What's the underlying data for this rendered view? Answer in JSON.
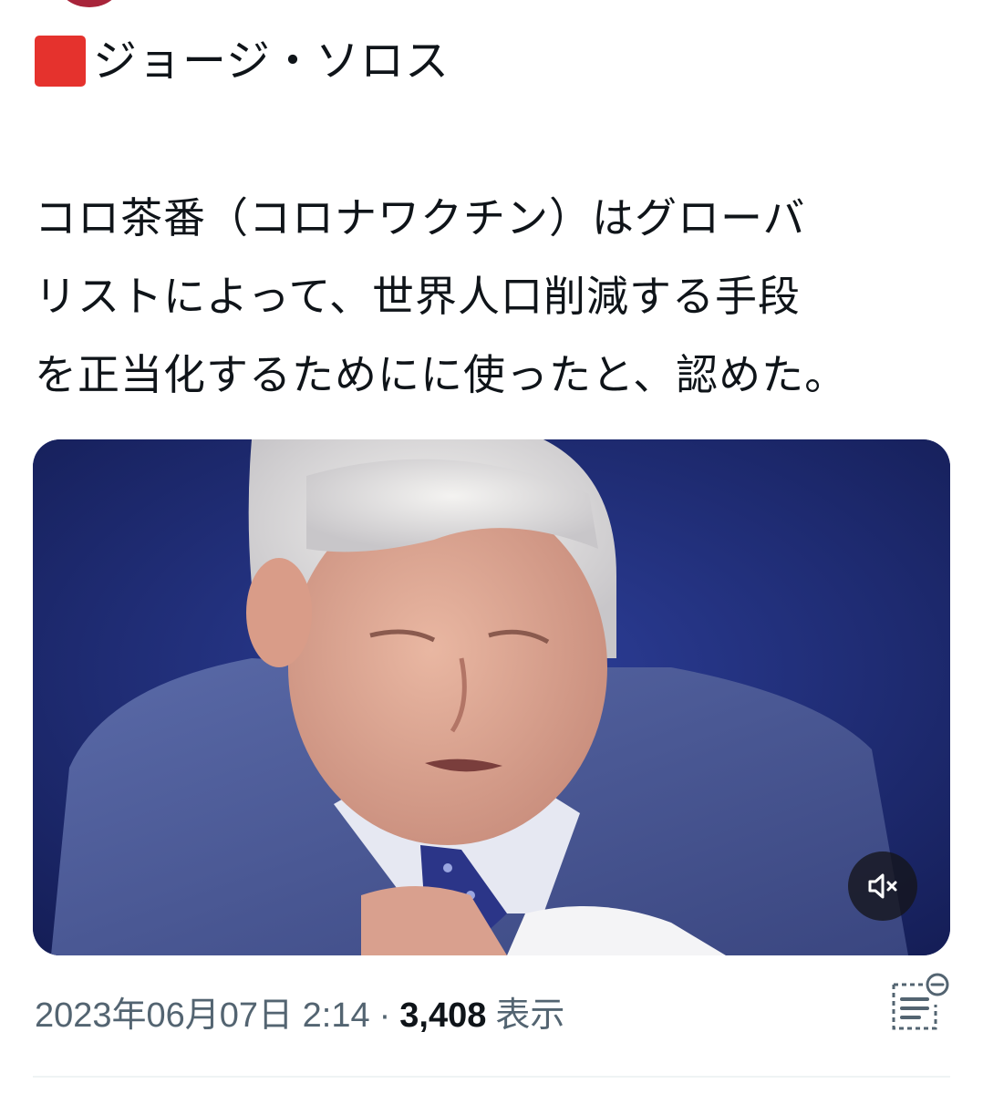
{
  "tweet": {
    "title": "ジョージ・ソロス",
    "title_icon": "red-square-icon",
    "body_lines": [
      "コロ茶番（コロナワクチン）はグローバ",
      "リストによって、世界人口削減する手段",
      "を正当化するためにに使ったと、認めた。"
    ],
    "media": {
      "type": "video",
      "mute_icon": "muted-speaker-icon"
    },
    "timestamp": "2023年06月07日 2:14",
    "separator": "·",
    "view_count": "3,408",
    "view_label": "表示",
    "note_icon": "community-note-icon"
  },
  "colors": {
    "accent_red": "#e5322d",
    "text_primary": "#0f1419",
    "text_secondary": "#536471",
    "video_background": "#1f2d7a"
  }
}
